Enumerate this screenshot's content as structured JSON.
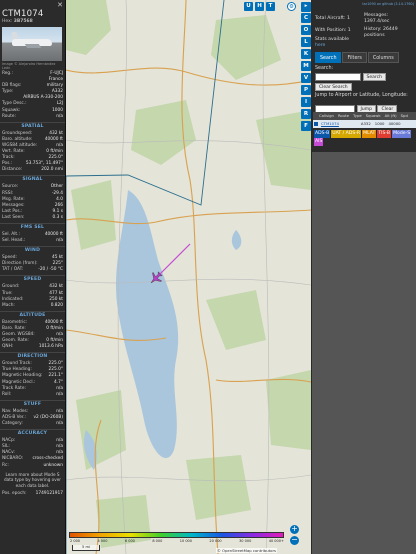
{
  "aircraft": {
    "callsign": "CTM1074",
    "hex_label": "Hex:",
    "hex": "3B7568",
    "close": "✕",
    "photo_credit": "Image © Alejandro Hernández León",
    "reg_label": "Reg.:",
    "reg": "F-UJCJ",
    "country": "France",
    "dbflags_label": "DB flags:",
    "dbflags": "military",
    "type_label": "Type:",
    "type": "A332",
    "typename": "AIRBUS A-330-200",
    "typedesc_label": "Type Desc.:",
    "typedesc": "L2J",
    "squawk_label": "Squawk:",
    "squawk": "1000",
    "route_label": "Route:",
    "route": "n/a"
  },
  "sections": [
    {
      "title": "SPATIAL",
      "rows": [
        [
          "Groundspeed:",
          "432 kt"
        ],
        [
          "Baro. altitude:",
          "40000 ft"
        ],
        [
          "WGS84 altitude:",
          "n/a"
        ],
        [
          "Vert. Rate:",
          "0 ft/min"
        ],
        [
          "Track:",
          "225.0°"
        ],
        [
          "Pos.:",
          "53.753°, 11.497°"
        ],
        [
          "Distance:",
          "202.0 nmi"
        ]
      ]
    },
    {
      "title": "SIGNAL",
      "rows": [
        [
          "Source:",
          "Other"
        ],
        [
          "RSSI:",
          "-29.4"
        ],
        [
          "Msg. Rate:",
          "4.0"
        ],
        [
          "Messages:",
          "266"
        ],
        [
          "Last Pos.:",
          "9.1 s"
        ],
        [
          "Last Seen:",
          "0.3 s"
        ]
      ]
    },
    {
      "title": "FMS SEL",
      "rows": [
        [
          "Sel. Alt.:",
          "40000 ft"
        ],
        [
          "Sel. Head.:",
          "n/a"
        ]
      ]
    },
    {
      "title": "WIND",
      "rows": [
        [
          "Speed:",
          "45 kt"
        ],
        [
          "Direction (from):",
          "225°"
        ],
        [
          "TAT / OAT:",
          "-20 / -50 °C"
        ]
      ]
    },
    {
      "title": "SPEED",
      "rows": [
        [
          "Ground:",
          "432 kt"
        ],
        [
          "True:",
          "477 kt"
        ],
        [
          "Indicated:",
          "250 kt"
        ],
        [
          "Mach:",
          "0.820"
        ]
      ]
    },
    {
      "title": "ALTITUDE",
      "rows": [
        [
          "Barometric:",
          "40000 ft"
        ],
        [
          "Baro. Rate:",
          "0 ft/min"
        ],
        [
          "Geom. WGS84:",
          "n/a"
        ],
        [
          "Geom. Rate:",
          "0 ft/min"
        ],
        [
          "QNH:",
          "1013.6 hPa"
        ]
      ]
    },
    {
      "title": "DIRECTION",
      "rows": [
        [
          "Ground Track:",
          "225.0°"
        ],
        [
          "True Heading:",
          "225.0°"
        ],
        [
          "Magnetic Heading:",
          "221.1°"
        ],
        [
          "Magnetic Decl.:",
          "4.7°"
        ],
        [
          "Track Rate:",
          "n/a"
        ],
        [
          "Roll:",
          "n/a"
        ]
      ]
    },
    {
      "title": "STUFF",
      "rows": [
        [
          "Nav. Modes:",
          "n/a"
        ],
        [
          "ADS-B Ver.:",
          "v2 (DO-260B)"
        ],
        [
          "Category:",
          "n/a"
        ]
      ]
    },
    {
      "title": "ACCURACY",
      "rows": [
        [
          "NACp:",
          "n/a"
        ],
        [
          "SIL:",
          "n/a"
        ],
        [
          "NACv:",
          "n/a"
        ],
        [
          "NICBARO:",
          "cross-checked"
        ],
        [
          "Rc:",
          "unknown"
        ]
      ]
    }
  ],
  "learn_more": "Learn more about Mode S data type by hovering over each data label.",
  "pos_epoch_label": "Pos. epoch:",
  "pos_epoch": "1749121917",
  "map": {
    "top_buttons": [
      "U",
      "H",
      "T"
    ],
    "side_buttons": [
      "C",
      "O",
      "L",
      "K",
      "M",
      "V",
      "P",
      "I",
      "R",
      "F"
    ],
    "zoom_in": "+",
    "zoom_out": "−",
    "legend_ticks": [
      "2 000",
      "4 000",
      "6 000",
      "8 000",
      "10 000",
      "20 000",
      "30 000",
      "40 000+"
    ],
    "scale": "5 mi",
    "attribution": "© OpenStreetMap contributors",
    "colors": {
      "track": "#c44bd4",
      "plane": "#b83ec9",
      "boundary": "#2b6e8e",
      "water": "#a9c6dd",
      "forest": "#bcd3a2",
      "road": "#d9a14f"
    }
  },
  "right_panel": {
    "link": "tar1090 on github (3.14.1760)",
    "total_label": "Total Aircraft: 1",
    "with_pos_label": "With Position: 1",
    "stats_label": "Stats available",
    "stats_link": "here",
    "messages_label": "Messages:",
    "messages": "1397.4/sec",
    "history_label": "History: 26449 positions",
    "tabs": [
      "Search",
      "Filters",
      "Columns"
    ],
    "search_label": "Search:",
    "search_button": "Search",
    "clear_search": "Clear Search",
    "jump_label": "Jump to Airport or Latitude, Longitude:",
    "jump_button": "Jump",
    "clear_button": "Clear",
    "table_headers": [
      "Callsign",
      "Route",
      "Type",
      "Squawk",
      "Alt (ft)",
      "Spd"
    ],
    "table_row": {
      "callsign": "CTM1074",
      "route": "",
      "type": "A332",
      "squawk": "1000",
      "alt": "40000",
      "spd": ""
    },
    "badges": [
      {
        "label": "ADS-B",
        "color": "#0b56a8"
      },
      {
        "label": "UAT / ADS-R",
        "color": "#d4a800"
      },
      {
        "label": "MLAT",
        "color": "#e28d00"
      },
      {
        "label": "TIS-B",
        "color": "#e03c31"
      },
      {
        "label": "Mode-S",
        "color": "#6a7ad8"
      },
      {
        "label": "AIS",
        "color": "#c44bd4"
      }
    ]
  }
}
